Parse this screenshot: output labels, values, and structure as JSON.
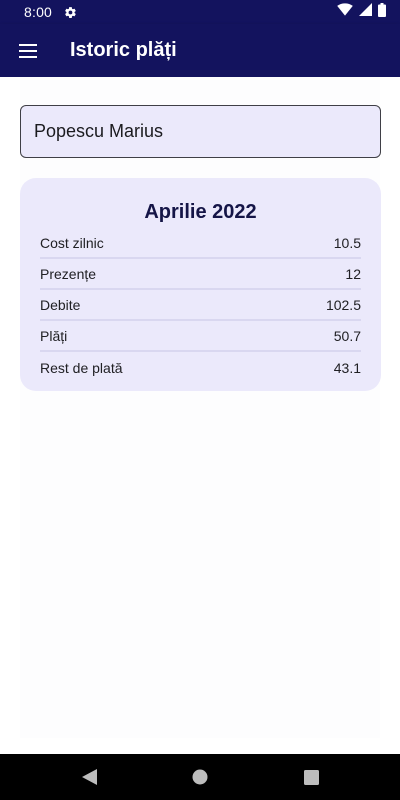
{
  "status_bar": {
    "time": "8:00",
    "icons": [
      "settings-icon",
      "wifi-icon",
      "signal-icon",
      "battery-icon"
    ]
  },
  "app_bar": {
    "title": "Istoric plăți",
    "menu_icon": "hamburger-menu-icon",
    "background": "#13135e"
  },
  "selector": {
    "value": "Popescu Marius"
  },
  "card": {
    "title": "Aprilie 2022",
    "rows": [
      {
        "label": "Cost zilnic",
        "value": "10.5"
      },
      {
        "label": "Prezențe",
        "value": "12"
      },
      {
        "label": "Debite",
        "value": "102.5"
      },
      {
        "label": "Plăți",
        "value": "50.7"
      },
      {
        "label": "Rest de plată",
        "value": "43.1"
      }
    ]
  },
  "nav_bar": {
    "buttons": [
      "back-icon",
      "home-icon",
      "recents-icon"
    ]
  },
  "colors": {
    "primary": "#13135e",
    "card_bg": "#ebe9fb",
    "divider": "#d9d7f0"
  }
}
